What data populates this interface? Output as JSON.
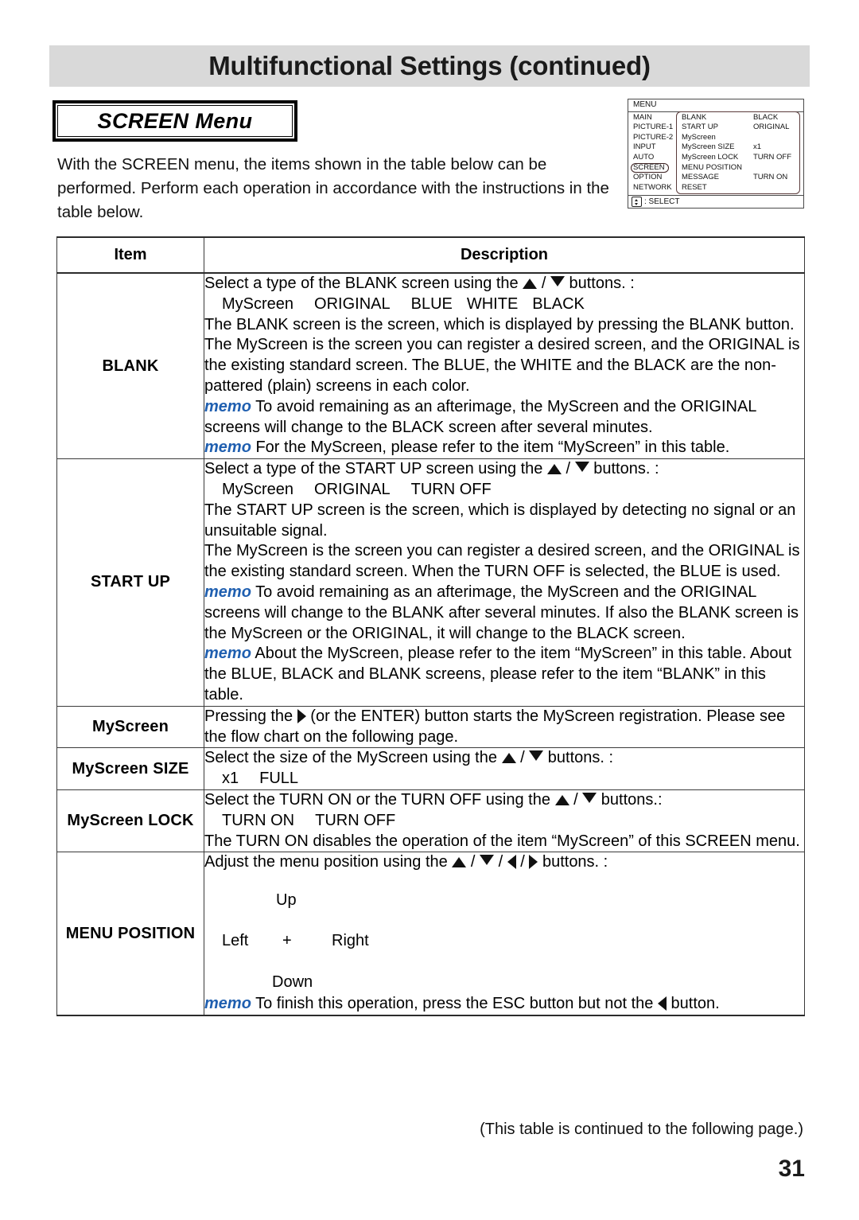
{
  "header": {
    "title": "Multifunctional Settings (continued)",
    "band_color": "#d9d9d9"
  },
  "section": {
    "box_label": "SCREEN Menu",
    "intro": "With the SCREEN menu, the items shown in the table below can be performed. Perform each operation in accordance with the instructions in the table below."
  },
  "osd_menu": {
    "titlebar": "MENU",
    "left_items": [
      "MAIN",
      "PICTURE-1",
      "PICTURE-2",
      "INPUT",
      "AUTO",
      "SCREEN",
      "OPTION",
      "NETWORK"
    ],
    "selected_left_item": "SCREEN",
    "entries": [
      {
        "name": "BLANK",
        "value": "BLACK"
      },
      {
        "name": "START UP",
        "value": "ORIGINAL"
      },
      {
        "name": "MyScreen",
        "value": ""
      },
      {
        "name": "MyScreen SIZE",
        "value": "x1"
      },
      {
        "name": "MyScreen LOCK",
        "value": "TURN OFF"
      },
      {
        "name": "MENU POSITION",
        "value": ""
      },
      {
        "name": "MESSAGE",
        "value": "TURN ON"
      },
      {
        "name": "RESET",
        "value": ""
      }
    ],
    "footer_label": ": SELECT",
    "footer_icon": "select-dpad-icon"
  },
  "table": {
    "headers": {
      "item": "Item",
      "description": "Description"
    },
    "rows": {
      "blank": {
        "item": "BLANK",
        "line1": "Select a type of the BLANK screen using the",
        "line1_mid": "/",
        "line1_end": "buttons. :",
        "options": [
          "MyScreen",
          "ORIGINAL",
          "BLUE",
          "WHITE",
          "BLACK"
        ],
        "p1": "The BLANK screen is the screen, which is displayed by pressing the BLANK button.",
        "p2": "The MyScreen is the screen you can register a desired screen, and the ORIGINAL is the existing standard screen. The BLUE, the WHITE and the BLACK are the non-pattered (plain) screens in each color.",
        "memo_label": "memo",
        "memo1": "To avoid remaining as an afterimage, the MyScreen and the ORIGINAL screens will change to the BLACK screen after several minutes.",
        "memo2": "For the MyScreen, please refer to the item “MyScreen” in this table."
      },
      "start_up": {
        "item": "START UP",
        "line1": "Select a type of the START UP screen using the",
        "line1_mid": "/",
        "line1_end": "buttons. :",
        "options": [
          "MyScreen",
          "ORIGINAL",
          "TURN OFF"
        ],
        "p1": "The START UP screen is the screen, which is displayed by detecting no signal or an unsuitable signal.",
        "p2": "The MyScreen is the screen you can register a desired screen, and the ORIGINAL is the existing standard screen. When the TURN OFF is selected, the BLUE is used.",
        "memo_label": "memo",
        "memo1": "To avoid remaining as an afterimage, the MyScreen and the ORIGINAL screens will change to the BLANK after several minutes. If also the BLANK screen is the MyScreen or the ORIGINAL, it will change to the BLACK screen.",
        "memo2": "About the MyScreen, please refer to the item “MyScreen” in this table. About the BLUE, BLACK and BLANK screens, please refer to the item “BLANK” in this table."
      },
      "myscreen": {
        "item": "MyScreen",
        "text_before": "Pressing the",
        "text_after": "(or the ENTER) button starts the MyScreen registration. Please see the flow chart on the following page."
      },
      "myscreen_size": {
        "item": "MyScreen SIZE",
        "line1": "Select the size of the MyScreen using the",
        "line1_mid": "/",
        "line1_end": "buttons. :",
        "options": [
          "x1",
          "FULL"
        ]
      },
      "myscreen_lock": {
        "item": "MyScreen LOCK",
        "line1": "Select the TURN ON or the TURN OFF using the",
        "line1_mid": "/",
        "line1_end": "buttons.:",
        "options": [
          "TURN ON",
          "TURN OFF"
        ],
        "p1": "The TURN ON disables the operation of the item “MyScreen” of this SCREEN menu."
      },
      "menu_position": {
        "item": "MENU POSITION",
        "line1": "Adjust the menu position using the",
        "line1_sep": "/",
        "line1_end": "buttons. :",
        "diagram": {
          "up": "Up",
          "left": "Left",
          "center": "+",
          "right": "Right",
          "down": "Down"
        },
        "memo_label": "memo",
        "memo1_before": "To finish this operation, press the ESC button but not the",
        "memo1_after": "button."
      }
    }
  },
  "footer": {
    "continued_note": "(This table is continued to the following page.)",
    "page_number": "31"
  },
  "colors": {
    "memo_blue": "#1f5fb0",
    "header_gray": "#d9d9d9",
    "rule": "#3a3a3a"
  }
}
